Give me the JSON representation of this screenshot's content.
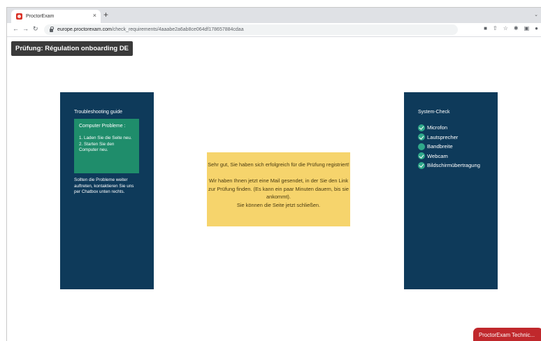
{
  "browser": {
    "tab_title": "ProctorExam",
    "new_tab_symbol": "+",
    "close_symbol": "×",
    "url_host": "europe.proctorexam.com",
    "url_path": "/check_requirements/4aaabe2a6ab8ce064df178657884cdaa"
  },
  "exam_label": "Prüfung: Régulation onboarding DE",
  "left_panel": {
    "title": "Troubleshooting guide",
    "problems_title": "Computer Probleme :",
    "problems_text": "1. Laden Sie die Seite neu.\n2. Starten Sie den Computer neu.",
    "note": "Sollten die Probleme weiter auftreten, kontaktieren Sie uns per Chatbox unten rechts."
  },
  "message": "Sehr gut, Sie haben sich erfolgreich für die Prüfung registriert!\n\nWir haben Ihnen jetzt eine Mail gesendet, in der Sie den Link zur Prüfung finden. (Es kann ein paar Minuten dauern, bis sie ankommt).\nSie können die Seite jetzt schließen.",
  "right_panel": {
    "title": "System-Check",
    "items": [
      {
        "label": "Microfon",
        "status": "ok"
      },
      {
        "label": "Lautsprecher",
        "status": "ok"
      },
      {
        "label": "Bandbreite",
        "status": "pending"
      },
      {
        "label": "Webcam",
        "status": "ok"
      },
      {
        "label": "Bildschirmübertragung",
        "status": "ok"
      }
    ]
  },
  "chat_button": "ProctorExam Technic...",
  "colors": {
    "panel": "#0e3a5a",
    "problems_box": "#1f8d6b",
    "message_box": "#f6d46c",
    "chat_button": "#c0282c"
  }
}
